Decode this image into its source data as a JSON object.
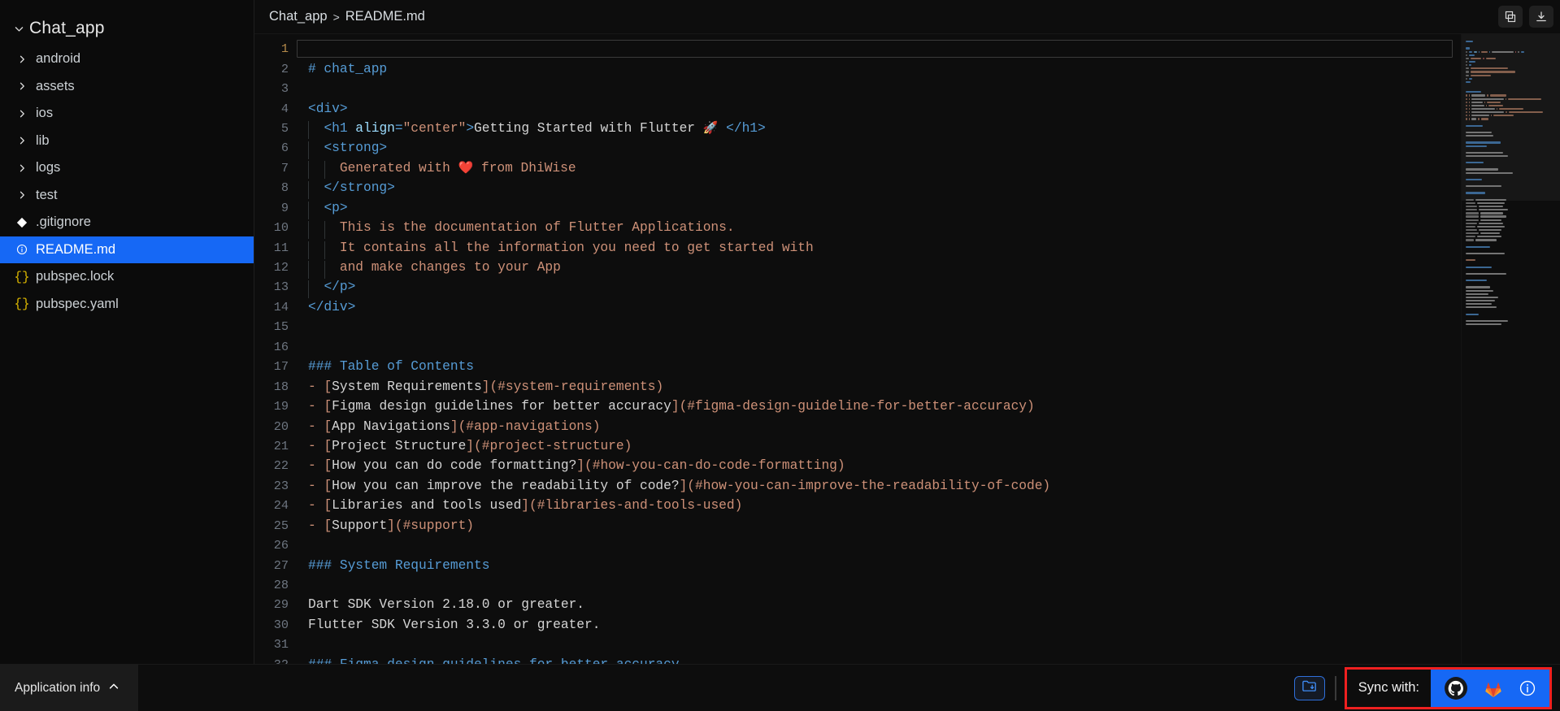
{
  "sidebar": {
    "root": {
      "label": "Chat_app",
      "chevron": "chevron-down"
    },
    "items": [
      {
        "label": "android",
        "icon": "chevron-right-icon",
        "kind": "folder",
        "selected": false
      },
      {
        "label": "assets",
        "icon": "chevron-right-icon",
        "kind": "folder",
        "selected": false
      },
      {
        "label": "ios",
        "icon": "chevron-right-icon",
        "kind": "folder",
        "selected": false
      },
      {
        "label": "lib",
        "icon": "chevron-right-icon",
        "kind": "folder",
        "selected": false
      },
      {
        "label": "logs",
        "icon": "chevron-right-icon",
        "kind": "folder",
        "selected": false
      },
      {
        "label": "test",
        "icon": "chevron-right-icon",
        "kind": "folder",
        "selected": false
      },
      {
        "label": ".gitignore",
        "icon": "git-icon",
        "kind": "file",
        "selected": false
      },
      {
        "label": "README.md",
        "icon": "markdown-info-icon",
        "kind": "file",
        "selected": true
      },
      {
        "label": "pubspec.lock",
        "icon": "json-braces-icon",
        "kind": "file",
        "selected": false
      },
      {
        "label": "pubspec.yaml",
        "icon": "json-braces-icon",
        "kind": "file",
        "selected": false
      }
    ]
  },
  "breadcrumb": {
    "project": "Chat_app",
    "separator": ">",
    "file": "README.md"
  },
  "toolbar": {
    "copy_icon": "copy-icon",
    "download_icon": "download-icon"
  },
  "editor": {
    "active_line": 1,
    "first_line": 1,
    "last_line": 32,
    "lines": [
      {
        "n": 1,
        "tokens": []
      },
      {
        "n": 2,
        "tokens": [
          {
            "t": "# chat_app",
            "c": "c-head"
          }
        ]
      },
      {
        "n": 3,
        "tokens": []
      },
      {
        "n": 4,
        "tokens": [
          {
            "t": "<div>",
            "c": "c-tag"
          }
        ]
      },
      {
        "n": 5,
        "indent": 1,
        "tokens": [
          {
            "t": "  ",
            "c": "c-plain"
          },
          {
            "t": "<h1 ",
            "c": "c-tag"
          },
          {
            "t": "align",
            "c": "c-attr"
          },
          {
            "t": "=",
            "c": "c-tag"
          },
          {
            "t": "\"center\"",
            "c": "c-str"
          },
          {
            "t": ">",
            "c": "c-tag"
          },
          {
            "t": "Getting Started with Flutter ",
            "c": "c-text"
          },
          {
            "t": "🚀",
            "c": "emoji"
          },
          {
            "t": " ",
            "c": "c-text"
          },
          {
            "t": "</h1>",
            "c": "c-tag"
          }
        ]
      },
      {
        "n": 6,
        "indent": 1,
        "tokens": [
          {
            "t": "  ",
            "c": "c-plain"
          },
          {
            "t": "<strong>",
            "c": "c-tag"
          }
        ]
      },
      {
        "n": 7,
        "indent": 2,
        "tokens": [
          {
            "t": "    ",
            "c": "c-plain"
          },
          {
            "t": "Generated with ",
            "c": "c-str"
          },
          {
            "t": "❤️",
            "c": "emoji"
          },
          {
            "t": " from DhiWise",
            "c": "c-str"
          }
        ]
      },
      {
        "n": 8,
        "indent": 1,
        "tokens": [
          {
            "t": "  ",
            "c": "c-plain"
          },
          {
            "t": "</strong>",
            "c": "c-tag"
          }
        ]
      },
      {
        "n": 9,
        "indent": 1,
        "tokens": [
          {
            "t": "  ",
            "c": "c-plain"
          },
          {
            "t": "<p>",
            "c": "c-tag"
          }
        ]
      },
      {
        "n": 10,
        "indent": 2,
        "tokens": [
          {
            "t": "    ",
            "c": "c-plain"
          },
          {
            "t": "This is the documentation of Flutter Applications.",
            "c": "c-str"
          }
        ]
      },
      {
        "n": 11,
        "indent": 2,
        "tokens": [
          {
            "t": "    ",
            "c": "c-plain"
          },
          {
            "t": "It contains all the information you need to get started with",
            "c": "c-str"
          }
        ]
      },
      {
        "n": 12,
        "indent": 2,
        "tokens": [
          {
            "t": "    ",
            "c": "c-plain"
          },
          {
            "t": "and make changes to your App",
            "c": "c-str"
          }
        ]
      },
      {
        "n": 13,
        "indent": 1,
        "tokens": [
          {
            "t": "  ",
            "c": "c-plain"
          },
          {
            "t": "</p>",
            "c": "c-tag"
          }
        ]
      },
      {
        "n": 14,
        "tokens": [
          {
            "t": "</div>",
            "c": "c-tag"
          }
        ]
      },
      {
        "n": 15,
        "tokens": []
      },
      {
        "n": 16,
        "tokens": []
      },
      {
        "n": 17,
        "tokens": [
          {
            "t": "### Table of Contents",
            "c": "c-head"
          }
        ]
      },
      {
        "n": 18,
        "tokens": [
          {
            "t": "- ",
            "c": "c-link"
          },
          {
            "t": "[",
            "c": "c-link"
          },
          {
            "t": "System Requirements",
            "c": "c-text"
          },
          {
            "t": "]",
            "c": "c-link"
          },
          {
            "t": "(#system-requirements)",
            "c": "c-link"
          }
        ]
      },
      {
        "n": 19,
        "tokens": [
          {
            "t": "- ",
            "c": "c-link"
          },
          {
            "t": "[",
            "c": "c-link"
          },
          {
            "t": "Figma design guidelines for better accuracy",
            "c": "c-text"
          },
          {
            "t": "]",
            "c": "c-link"
          },
          {
            "t": "(#figma-design-guideline-for-better-accuracy)",
            "c": "c-link"
          }
        ]
      },
      {
        "n": 20,
        "tokens": [
          {
            "t": "- ",
            "c": "c-link"
          },
          {
            "t": "[",
            "c": "c-link"
          },
          {
            "t": "App Navigations",
            "c": "c-text"
          },
          {
            "t": "]",
            "c": "c-link"
          },
          {
            "t": "(#app-navigations)",
            "c": "c-link"
          }
        ]
      },
      {
        "n": 21,
        "tokens": [
          {
            "t": "- ",
            "c": "c-link"
          },
          {
            "t": "[",
            "c": "c-link"
          },
          {
            "t": "Project Structure",
            "c": "c-text"
          },
          {
            "t": "]",
            "c": "c-link"
          },
          {
            "t": "(#project-structure)",
            "c": "c-link"
          }
        ]
      },
      {
        "n": 22,
        "tokens": [
          {
            "t": "- ",
            "c": "c-link"
          },
          {
            "t": "[",
            "c": "c-link"
          },
          {
            "t": "How you can do code formatting?",
            "c": "c-text"
          },
          {
            "t": "]",
            "c": "c-link"
          },
          {
            "t": "(#how-you-can-do-code-formatting)",
            "c": "c-link"
          }
        ]
      },
      {
        "n": 23,
        "tokens": [
          {
            "t": "- ",
            "c": "c-link"
          },
          {
            "t": "[",
            "c": "c-link"
          },
          {
            "t": "How you can improve the readability of code?",
            "c": "c-text"
          },
          {
            "t": "]",
            "c": "c-link"
          },
          {
            "t": "(#how-you-can-improve-the-readability-of-code)",
            "c": "c-link"
          }
        ]
      },
      {
        "n": 24,
        "tokens": [
          {
            "t": "- ",
            "c": "c-link"
          },
          {
            "t": "[",
            "c": "c-link"
          },
          {
            "t": "Libraries and tools used",
            "c": "c-text"
          },
          {
            "t": "]",
            "c": "c-link"
          },
          {
            "t": "(#libraries-and-tools-used)",
            "c": "c-link"
          }
        ]
      },
      {
        "n": 25,
        "tokens": [
          {
            "t": "- ",
            "c": "c-link"
          },
          {
            "t": "[",
            "c": "c-link"
          },
          {
            "t": "Support",
            "c": "c-text"
          },
          {
            "t": "]",
            "c": "c-link"
          },
          {
            "t": "(#support)",
            "c": "c-link"
          }
        ]
      },
      {
        "n": 26,
        "tokens": []
      },
      {
        "n": 27,
        "tokens": [
          {
            "t": "### System Requirements",
            "c": "c-head"
          }
        ]
      },
      {
        "n": 28,
        "tokens": []
      },
      {
        "n": 29,
        "tokens": [
          {
            "t": "Dart SDK Version 2.18.0 or greater.",
            "c": "c-text"
          }
        ]
      },
      {
        "n": 30,
        "tokens": [
          {
            "t": "Flutter SDK Version 3.3.0 or greater.",
            "c": "c-text"
          }
        ]
      },
      {
        "n": 31,
        "tokens": []
      },
      {
        "n": 32,
        "tokens": [
          {
            "t": "### Figma design guidelines for better accuracy",
            "c": "c-head"
          }
        ]
      }
    ]
  },
  "status_bar": {
    "app_info_label": "Application info",
    "app_info_caret": "chevron-up-icon",
    "folder_download_icon": "folder-download-icon",
    "sync_label": "Sync with:",
    "sync_targets": [
      {
        "name": "github-icon",
        "title": "GitHub"
      },
      {
        "name": "gitlab-icon",
        "title": "GitLab"
      },
      {
        "name": "info-icon",
        "title": "Info"
      }
    ]
  },
  "colors": {
    "accent_blue": "#1668f5",
    "highlight_red": "#ef2020",
    "editor_bg": "#0d0d0d",
    "sidebar_bg": "#0b0b0b",
    "tag_blue": "#569cd6",
    "string_orange": "#ce9178",
    "text_gray": "#d4d4d4"
  }
}
